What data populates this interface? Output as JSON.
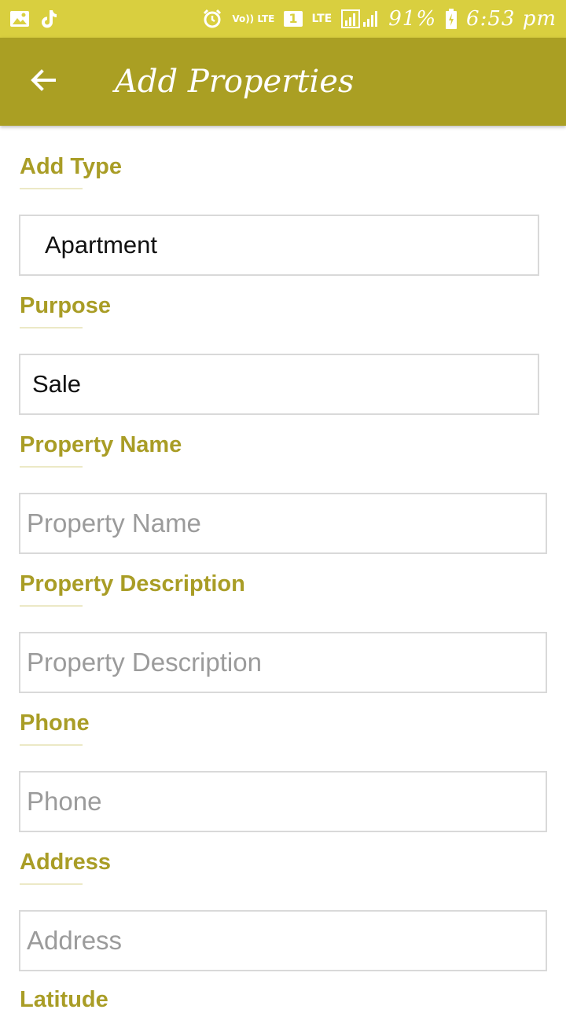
{
  "status_bar": {
    "volte_label": "Vo)) LTE",
    "sim_label": "1",
    "lte_label": "LTE",
    "battery": "91%",
    "time": "6:53 pm",
    "icons": [
      "gallery-icon",
      "tiktok-icon",
      "alarm-icon",
      "signal-icon",
      "battery-icon"
    ]
  },
  "app_bar": {
    "title": "Add Properties",
    "back_icon": "arrow-left-icon",
    "color": "#aa9f23"
  },
  "form": {
    "add_type": {
      "label": "Add Type",
      "value": "Apartment"
    },
    "purpose": {
      "label": "Purpose",
      "value": "Sale"
    },
    "property_name": {
      "label": "Property Name",
      "placeholder": "Property Name",
      "value": ""
    },
    "property_description": {
      "label": "Property Description",
      "placeholder": "Property Description",
      "value": ""
    },
    "phone": {
      "label": "Phone",
      "placeholder": "Phone",
      "value": ""
    },
    "address": {
      "label": "Address",
      "placeholder": "Address",
      "value": ""
    },
    "latitude": {
      "label": "Latitude"
    }
  },
  "colors": {
    "status_bar": "#d9cf3f",
    "accent": "#a99d26"
  }
}
